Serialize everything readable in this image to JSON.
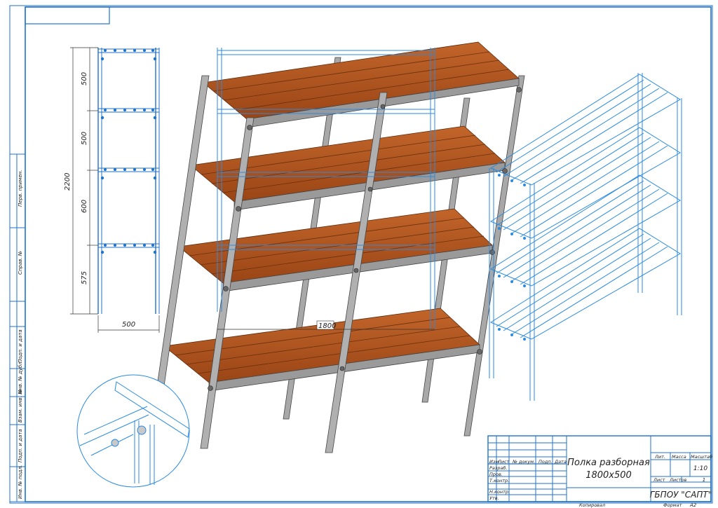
{
  "dimensions": {
    "overall_height": "2200",
    "tier_1": "500",
    "tier_2": "500",
    "tier_3": "600",
    "tier_4": "575",
    "depth": "500",
    "length": "1800"
  },
  "side_strip": {
    "perv_primen": "Перв. примен.",
    "sprav_no": "Справ. №",
    "podp_data_1": "Подп. и дата",
    "inv_dubl": "Инв. № дубл.",
    "vzam_inv": "Взам. инв. №",
    "podp_data_2": "Подп. и дата",
    "inv_podl": "Инв. № подл."
  },
  "title_block": {
    "col_izm": "Изм",
    "col_list": "Лист",
    "col_doc": "№ докум.",
    "col_podp": "Подп.",
    "col_data": "Дата",
    "razrab": "Разраб.",
    "prov": "Пров.",
    "tkontr": "Т.контр.",
    "nkontr": "Н.контр.",
    "utv": "Утв.",
    "name_line1": "Полка разборная",
    "name_line2": "1800х500",
    "lit": "Лит.",
    "massa": "Масса",
    "masshtab": "Масштаб",
    "scale": "1:10",
    "list": "Лист",
    "listov": "Листов",
    "listov_value": "1",
    "org": "ГБПОУ \"САПТ\"",
    "kopiroval": "Копировал",
    "format": "Формат",
    "format_value": "А2"
  },
  "colors": {
    "frame": "#1f73c8",
    "wireframe": "#2a8ae0",
    "steel": "#a8a8a8",
    "steel_dark": "#5a5a5a",
    "wood": "#b5561f",
    "wood_dark": "#7a3410"
  }
}
